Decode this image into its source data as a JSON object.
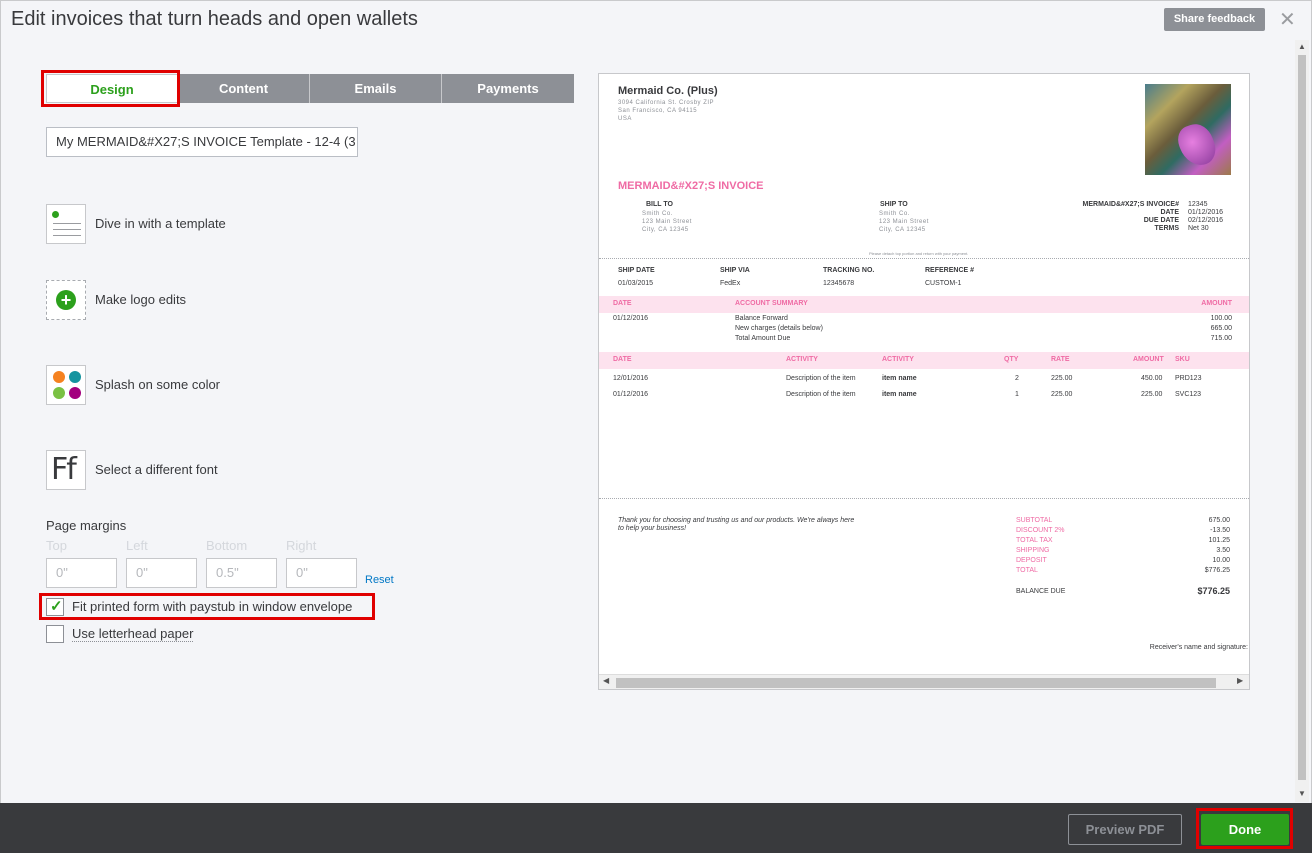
{
  "header": {
    "title": "Edit invoices that turn heads and open wallets",
    "share_feedback": "Share feedback",
    "close": "✕"
  },
  "tabs": [
    {
      "label": "Design"
    },
    {
      "label": "Content"
    },
    {
      "label": "Emails"
    },
    {
      "label": "Payments"
    }
  ],
  "template_name": "My MERMAID&#X27;S INVOICE Template - 12-4 (3",
  "design_options": [
    {
      "label": "Dive in with a template",
      "icon": "template-icon"
    },
    {
      "label": "Make logo edits",
      "icon": "add-logo-icon"
    },
    {
      "label": "Splash on some color",
      "icon": "color-palette-icon"
    },
    {
      "label": "Select a different font",
      "icon": "font-icon"
    }
  ],
  "palette_colors": [
    "#f58220",
    "#15949f",
    "#7ac143",
    "#a3007e"
  ],
  "margins": {
    "label": "Page margins",
    "fields": [
      {
        "label": "Top",
        "value": "0\""
      },
      {
        "label": "Left",
        "value": "0\""
      },
      {
        "label": "Bottom",
        "value": "0.5\""
      },
      {
        "label": "Right",
        "value": "0\""
      }
    ],
    "reset": "Reset"
  },
  "checkboxes": [
    {
      "label": "Fit printed form with paystub in window envelope",
      "checked": true
    },
    {
      "label": "Use letterhead paper",
      "checked": false
    }
  ],
  "invoice": {
    "company": "Mermaid Co. (Plus)",
    "address_lines": [
      "3094 California St. Crosby ZIP",
      "San Francisco, CA 94115",
      "USA"
    ],
    "title": "MERMAID&#X27;S INVOICE",
    "bill_to_label": "BILL TO",
    "ship_to_label": "SHIP TO",
    "bill_to_lines": [
      "Smith Co.",
      "123 Main Street",
      "City, CA 12345"
    ],
    "ship_to_lines": [
      "Smith Co.",
      "123 Main Street",
      "City, CA 12345"
    ],
    "meta": [
      {
        "label": "MERMAID&#X27;S INVOICE#",
        "value": "12345"
      },
      {
        "label": "DATE",
        "value": "01/12/2016"
      },
      {
        "label": "DUE DATE",
        "value": "02/12/2016"
      },
      {
        "label": "TERMS",
        "value": "Net 30"
      }
    ],
    "detach_note": "Please detach top portion and return with your payment.",
    "shipping": {
      "headers": [
        "SHIP DATE",
        "SHIP VIA",
        "TRACKING NO.",
        "REFERENCE #"
      ],
      "values": [
        "01/03/2015",
        "FedEx",
        "12345678",
        "CUSTOM-1"
      ]
    },
    "summary": {
      "headers": {
        "date": "DATE",
        "desc": "ACCOUNT SUMMARY",
        "amount": "AMOUNT"
      },
      "date": "01/12/2016",
      "rows": [
        {
          "desc": "Balance Forward",
          "amount": "100.00"
        },
        {
          "desc": "New charges (details below)",
          "amount": "665.00"
        },
        {
          "desc": "Total Amount Due",
          "amount": "715.00"
        }
      ]
    },
    "items": {
      "headers": {
        "date": "DATE",
        "activity1": "ACTIVITY",
        "activity2": "ACTIVITY",
        "qty": "QTY",
        "rate": "RATE",
        "amount": "AMOUNT",
        "sku": "SKU"
      },
      "rows": [
        {
          "date": "12/01/2016",
          "desc": "Description of the item",
          "name": "item name",
          "qty": "2",
          "rate": "225.00",
          "amount": "450.00",
          "sku": "PRD123"
        },
        {
          "date": "01/12/2016",
          "desc": "Description of the item",
          "name": "item name",
          "qty": "1",
          "rate": "225.00",
          "amount": "225.00",
          "sku": "SVC123"
        }
      ]
    },
    "thanks_lines": [
      "Thank you for choosing and trusting us and our products. We're always here",
      "to help your business!"
    ],
    "totals": [
      {
        "label": "SUBTOTAL",
        "value": "675.00"
      },
      {
        "label": "DISCOUNT 2%",
        "value": "-13.50"
      },
      {
        "label": "TOTAL TAX",
        "value": "101.25"
      },
      {
        "label": "SHIPPING",
        "value": "3.50"
      },
      {
        "label": "DEPOSIT",
        "value": "10.00"
      },
      {
        "label": "TOTAL",
        "value": "$776.25"
      }
    ],
    "balance_due_label": "BALANCE DUE",
    "balance_due_value": "$776.25",
    "signature_label": "Receiver's name and signature:"
  },
  "footer": {
    "preview_pdf": "Preview PDF",
    "done": "Done"
  },
  "colors": {
    "accent_green": "#2ca01c",
    "invoice_pink": "#ef6ba4",
    "highlight_red": "#e00000"
  }
}
